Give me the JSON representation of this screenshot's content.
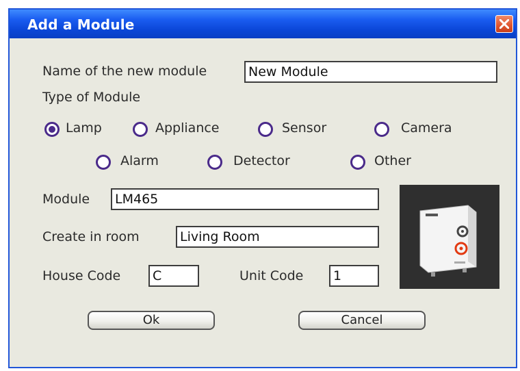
{
  "dialog": {
    "title": "Add a Module",
    "close_icon": "close-icon"
  },
  "form": {
    "name_label": "Name of the new module",
    "name_value": "New Module",
    "type_label": "Type of Module",
    "module_types": [
      {
        "label": "Lamp",
        "checked": true
      },
      {
        "label": "Appliance",
        "checked": false
      },
      {
        "label": "Sensor",
        "checked": false
      },
      {
        "label": "Camera",
        "checked": false
      },
      {
        "label": "Alarm",
        "checked": false
      },
      {
        "label": "Detector",
        "checked": false
      },
      {
        "label": "Other",
        "checked": false
      }
    ],
    "module_label": "Module",
    "module_value": "LM465",
    "room_label": "Create in room",
    "room_value": "Living Room",
    "house_code_label": "House Code",
    "house_code_value": "C",
    "unit_code_label": "Unit Code",
    "unit_code_value": "1"
  },
  "buttons": {
    "ok": "Ok",
    "cancel": "Cancel"
  },
  "colors": {
    "titlebar": "#0b47d8",
    "radio_accent": "#4a2a8a",
    "close_button": "#e0542e"
  }
}
